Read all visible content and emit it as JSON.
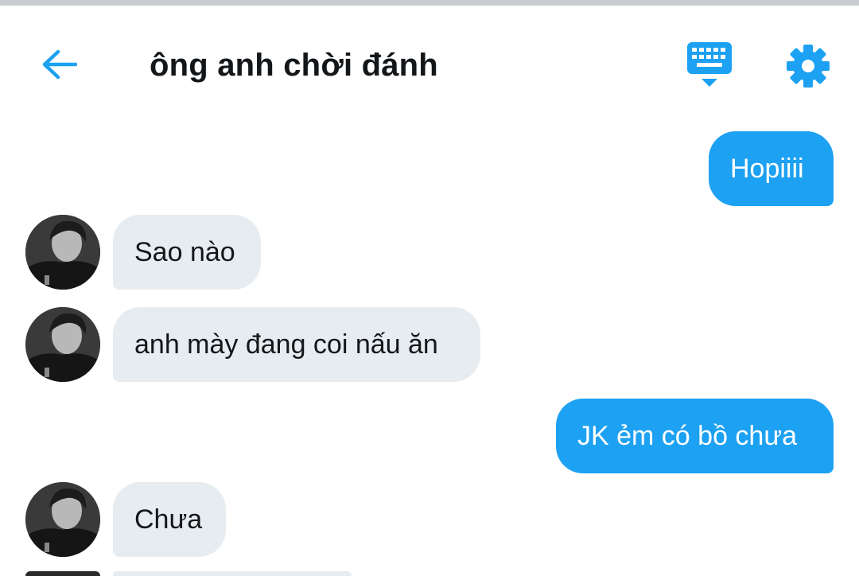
{
  "header": {
    "title": "ông anh chời đánh",
    "back_icon": "arrow-left-icon",
    "keyboard_icon": "keyboard-icon",
    "settings_icon": "gear-icon",
    "accent_color": "#1da1f2"
  },
  "messages": [
    {
      "direction": "sent",
      "text": "Hopiiii"
    },
    {
      "direction": "received",
      "text": "Sao nào"
    },
    {
      "direction": "received",
      "text": "anh mày đang coi nấu ăn"
    },
    {
      "direction": "sent",
      "text": "JK ẻm có bồ chưa"
    },
    {
      "direction": "received",
      "text": "Chưa"
    }
  ],
  "colors": {
    "sent_bubble": "#1da1f2",
    "received_bubble": "#e6ecf0",
    "text_dark": "#14171a"
  }
}
